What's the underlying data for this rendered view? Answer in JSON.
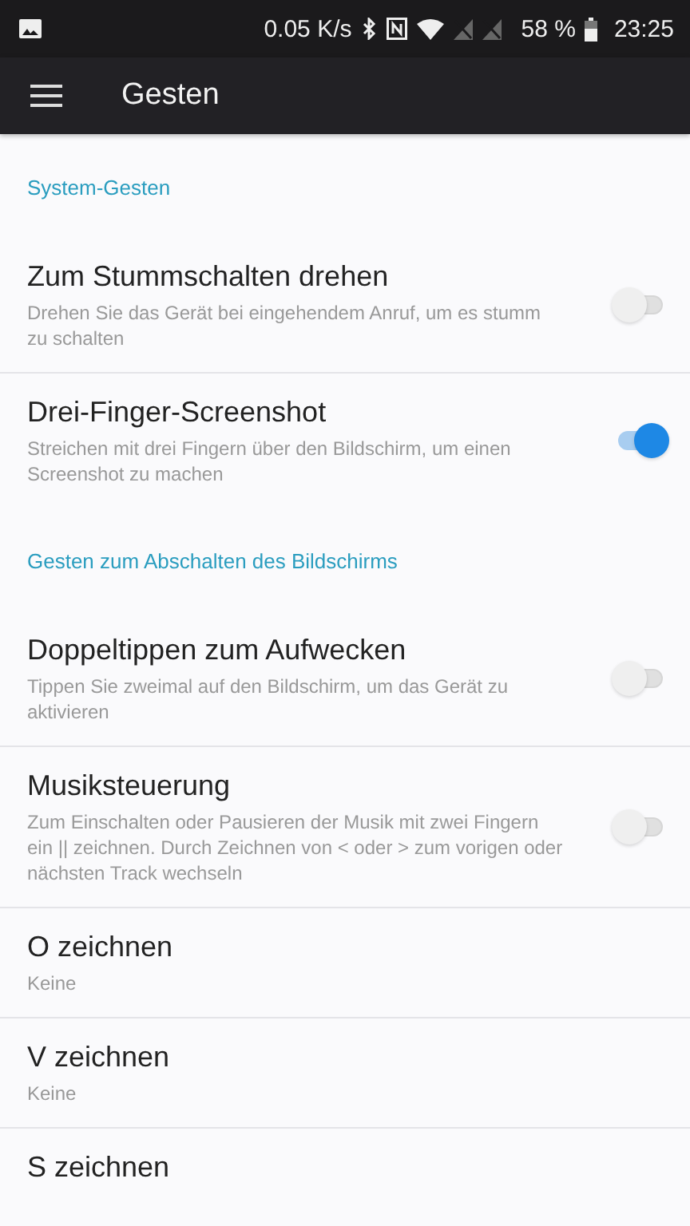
{
  "status_bar": {
    "speed": "0.05 K/s",
    "battery": "58 %",
    "time": "23:25"
  },
  "toolbar": {
    "title": "Gesten"
  },
  "sections": [
    {
      "title": "System-Gesten",
      "items": [
        {
          "kind": "switch",
          "title": "Zum Stummschalten drehen",
          "summary": "Drehen Sie das Gerät bei eingehendem Anruf, um es stumm zu schalten",
          "on": false
        },
        {
          "kind": "switch",
          "title": "Drei-Finger-Screenshot",
          "summary": "Streichen mit drei Fingern über den Bildschirm, um einen Screenshot zu machen",
          "on": true
        }
      ]
    },
    {
      "title": "Gesten zum Abschalten des Bildschirms",
      "items": [
        {
          "kind": "switch",
          "title": "Doppeltippen zum Aufwecken",
          "summary": "Tippen Sie zweimal auf den Bildschirm, um das Gerät zu aktivieren",
          "on": false
        },
        {
          "kind": "switch",
          "title": "Musiksteuerung",
          "summary": "Zum Einschalten oder Pausieren der Musik mit zwei Fingern ein || zeichnen. Durch Zeichnen von < oder > zum vorigen oder nächsten Track wechseln",
          "on": false
        },
        {
          "kind": "value",
          "title": "O zeichnen",
          "summary": "Keine"
        },
        {
          "kind": "value",
          "title": "V zeichnen",
          "summary": "Keine"
        },
        {
          "kind": "value",
          "title": "S zeichnen"
        }
      ]
    }
  ]
}
